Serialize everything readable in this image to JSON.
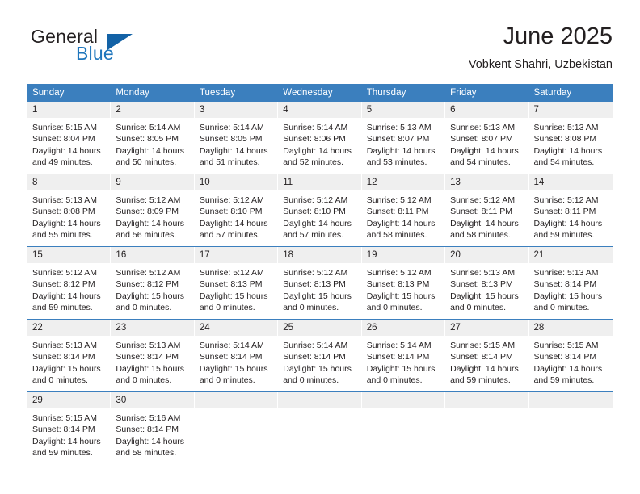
{
  "brand": {
    "name_primary": "General",
    "name_secondary": "Blue",
    "triangle_icon": "blue-triangle-logo-icon",
    "accent_color": "#1f76bc"
  },
  "header": {
    "title": "June 2025",
    "subtitle": "Vobkent Shahri, Uzbekistan"
  },
  "theme": {
    "header_band": "#3b7fbe",
    "daynum_band": "#efefef",
    "text": "#231f20"
  },
  "weekday_headers": [
    "Sunday",
    "Monday",
    "Tuesday",
    "Wednesday",
    "Thursday",
    "Friday",
    "Saturday"
  ],
  "labels": {
    "sunrise_prefix": "Sunrise:",
    "sunset_prefix": "Sunset:",
    "daylight_prefix": "Daylight:"
  },
  "weeks": [
    [
      {
        "day": "1",
        "sunrise": "Sunrise: 5:15 AM",
        "sunset": "Sunset: 8:04 PM",
        "daylight_line1": "Daylight: 14 hours",
        "daylight_line2": "and 49 minutes."
      },
      {
        "day": "2",
        "sunrise": "Sunrise: 5:14 AM",
        "sunset": "Sunset: 8:05 PM",
        "daylight_line1": "Daylight: 14 hours",
        "daylight_line2": "and 50 minutes."
      },
      {
        "day": "3",
        "sunrise": "Sunrise: 5:14 AM",
        "sunset": "Sunset: 8:05 PM",
        "daylight_line1": "Daylight: 14 hours",
        "daylight_line2": "and 51 minutes."
      },
      {
        "day": "4",
        "sunrise": "Sunrise: 5:14 AM",
        "sunset": "Sunset: 8:06 PM",
        "daylight_line1": "Daylight: 14 hours",
        "daylight_line2": "and 52 minutes."
      },
      {
        "day": "5",
        "sunrise": "Sunrise: 5:13 AM",
        "sunset": "Sunset: 8:07 PM",
        "daylight_line1": "Daylight: 14 hours",
        "daylight_line2": "and 53 minutes."
      },
      {
        "day": "6",
        "sunrise": "Sunrise: 5:13 AM",
        "sunset": "Sunset: 8:07 PM",
        "daylight_line1": "Daylight: 14 hours",
        "daylight_line2": "and 54 minutes."
      },
      {
        "day": "7",
        "sunrise": "Sunrise: 5:13 AM",
        "sunset": "Sunset: 8:08 PM",
        "daylight_line1": "Daylight: 14 hours",
        "daylight_line2": "and 54 minutes."
      }
    ],
    [
      {
        "day": "8",
        "sunrise": "Sunrise: 5:13 AM",
        "sunset": "Sunset: 8:08 PM",
        "daylight_line1": "Daylight: 14 hours",
        "daylight_line2": "and 55 minutes."
      },
      {
        "day": "9",
        "sunrise": "Sunrise: 5:12 AM",
        "sunset": "Sunset: 8:09 PM",
        "daylight_line1": "Daylight: 14 hours",
        "daylight_line2": "and 56 minutes."
      },
      {
        "day": "10",
        "sunrise": "Sunrise: 5:12 AM",
        "sunset": "Sunset: 8:10 PM",
        "daylight_line1": "Daylight: 14 hours",
        "daylight_line2": "and 57 minutes."
      },
      {
        "day": "11",
        "sunrise": "Sunrise: 5:12 AM",
        "sunset": "Sunset: 8:10 PM",
        "daylight_line1": "Daylight: 14 hours",
        "daylight_line2": "and 57 minutes."
      },
      {
        "day": "12",
        "sunrise": "Sunrise: 5:12 AM",
        "sunset": "Sunset: 8:11 PM",
        "daylight_line1": "Daylight: 14 hours",
        "daylight_line2": "and 58 minutes."
      },
      {
        "day": "13",
        "sunrise": "Sunrise: 5:12 AM",
        "sunset": "Sunset: 8:11 PM",
        "daylight_line1": "Daylight: 14 hours",
        "daylight_line2": "and 58 minutes."
      },
      {
        "day": "14",
        "sunrise": "Sunrise: 5:12 AM",
        "sunset": "Sunset: 8:11 PM",
        "daylight_line1": "Daylight: 14 hours",
        "daylight_line2": "and 59 minutes."
      }
    ],
    [
      {
        "day": "15",
        "sunrise": "Sunrise: 5:12 AM",
        "sunset": "Sunset: 8:12 PM",
        "daylight_line1": "Daylight: 14 hours",
        "daylight_line2": "and 59 minutes."
      },
      {
        "day": "16",
        "sunrise": "Sunrise: 5:12 AM",
        "sunset": "Sunset: 8:12 PM",
        "daylight_line1": "Daylight: 15 hours",
        "daylight_line2": "and 0 minutes."
      },
      {
        "day": "17",
        "sunrise": "Sunrise: 5:12 AM",
        "sunset": "Sunset: 8:13 PM",
        "daylight_line1": "Daylight: 15 hours",
        "daylight_line2": "and 0 minutes."
      },
      {
        "day": "18",
        "sunrise": "Sunrise: 5:12 AM",
        "sunset": "Sunset: 8:13 PM",
        "daylight_line1": "Daylight: 15 hours",
        "daylight_line2": "and 0 minutes."
      },
      {
        "day": "19",
        "sunrise": "Sunrise: 5:12 AM",
        "sunset": "Sunset: 8:13 PM",
        "daylight_line1": "Daylight: 15 hours",
        "daylight_line2": "and 0 minutes."
      },
      {
        "day": "20",
        "sunrise": "Sunrise: 5:13 AM",
        "sunset": "Sunset: 8:13 PM",
        "daylight_line1": "Daylight: 15 hours",
        "daylight_line2": "and 0 minutes."
      },
      {
        "day": "21",
        "sunrise": "Sunrise: 5:13 AM",
        "sunset": "Sunset: 8:14 PM",
        "daylight_line1": "Daylight: 15 hours",
        "daylight_line2": "and 0 minutes."
      }
    ],
    [
      {
        "day": "22",
        "sunrise": "Sunrise: 5:13 AM",
        "sunset": "Sunset: 8:14 PM",
        "daylight_line1": "Daylight: 15 hours",
        "daylight_line2": "and 0 minutes."
      },
      {
        "day": "23",
        "sunrise": "Sunrise: 5:13 AM",
        "sunset": "Sunset: 8:14 PM",
        "daylight_line1": "Daylight: 15 hours",
        "daylight_line2": "and 0 minutes."
      },
      {
        "day": "24",
        "sunrise": "Sunrise: 5:14 AM",
        "sunset": "Sunset: 8:14 PM",
        "daylight_line1": "Daylight: 15 hours",
        "daylight_line2": "and 0 minutes."
      },
      {
        "day": "25",
        "sunrise": "Sunrise: 5:14 AM",
        "sunset": "Sunset: 8:14 PM",
        "daylight_line1": "Daylight: 15 hours",
        "daylight_line2": "and 0 minutes."
      },
      {
        "day": "26",
        "sunrise": "Sunrise: 5:14 AM",
        "sunset": "Sunset: 8:14 PM",
        "daylight_line1": "Daylight: 15 hours",
        "daylight_line2": "and 0 minutes."
      },
      {
        "day": "27",
        "sunrise": "Sunrise: 5:15 AM",
        "sunset": "Sunset: 8:14 PM",
        "daylight_line1": "Daylight: 14 hours",
        "daylight_line2": "and 59 minutes."
      },
      {
        "day": "28",
        "sunrise": "Sunrise: 5:15 AM",
        "sunset": "Sunset: 8:14 PM",
        "daylight_line1": "Daylight: 14 hours",
        "daylight_line2": "and 59 minutes."
      }
    ],
    [
      {
        "day": "29",
        "sunrise": "Sunrise: 5:15 AM",
        "sunset": "Sunset: 8:14 PM",
        "daylight_line1": "Daylight: 14 hours",
        "daylight_line2": "and 59 minutes."
      },
      {
        "day": "30",
        "sunrise": "Sunrise: 5:16 AM",
        "sunset": "Sunset: 8:14 PM",
        "daylight_line1": "Daylight: 14 hours",
        "daylight_line2": "and 58 minutes."
      },
      {
        "day": "",
        "sunrise": "",
        "sunset": "",
        "daylight_line1": "",
        "daylight_line2": ""
      },
      {
        "day": "",
        "sunrise": "",
        "sunset": "",
        "daylight_line1": "",
        "daylight_line2": ""
      },
      {
        "day": "",
        "sunrise": "",
        "sunset": "",
        "daylight_line1": "",
        "daylight_line2": ""
      },
      {
        "day": "",
        "sunrise": "",
        "sunset": "",
        "daylight_line1": "",
        "daylight_line2": ""
      },
      {
        "day": "",
        "sunrise": "",
        "sunset": "",
        "daylight_line1": "",
        "daylight_line2": ""
      }
    ]
  ]
}
